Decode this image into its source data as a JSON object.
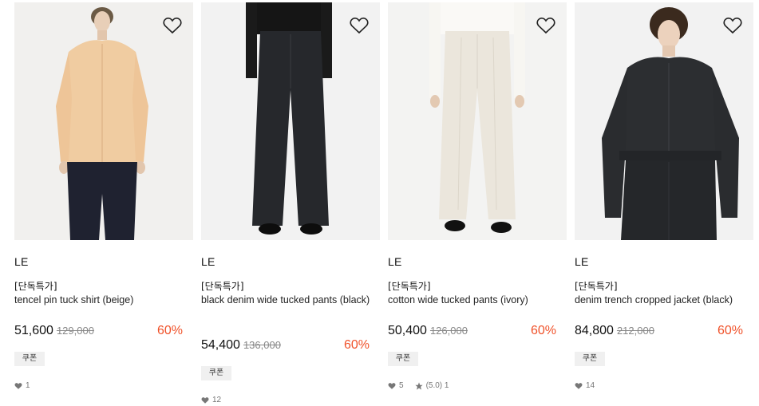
{
  "products": [
    {
      "brand": "LE",
      "promo": "[단독특가]",
      "title": "tencel pin tuck shirt (beige)",
      "price": "51,600",
      "original_price": "129,000",
      "discount": "60%",
      "coupon": "쿠폰",
      "likes": "1",
      "rating": null,
      "image_icon": "model-beige-shirt"
    },
    {
      "brand": "LE",
      "promo": "[단독특가]",
      "title": "black denim wide tucked pants (black)",
      "price": "54,400",
      "original_price": "136,000",
      "discount": "60%",
      "coupon": "쿠폰",
      "likes": "12",
      "rating": null,
      "image_icon": "black-denim-pants"
    },
    {
      "brand": "LE",
      "promo": "[단독특가]",
      "title": "cotton wide tucked pants (ivory)",
      "price": "50,400",
      "original_price": "126,000",
      "discount": "60%",
      "coupon": "쿠폰",
      "likes": "5",
      "rating": "(5.0) 1",
      "image_icon": "ivory-pants"
    },
    {
      "brand": "LE",
      "promo": "[단독특가]",
      "title": "denim trench cropped jacket (black)",
      "price": "84,800",
      "original_price": "212,000",
      "discount": "60%",
      "coupon": "쿠폰",
      "likes": "14",
      "rating": null,
      "image_icon": "model-black-denim-jacket"
    }
  ],
  "colors": {
    "discount": "#f0522a",
    "coupon_bg": "#f0f0f0"
  }
}
